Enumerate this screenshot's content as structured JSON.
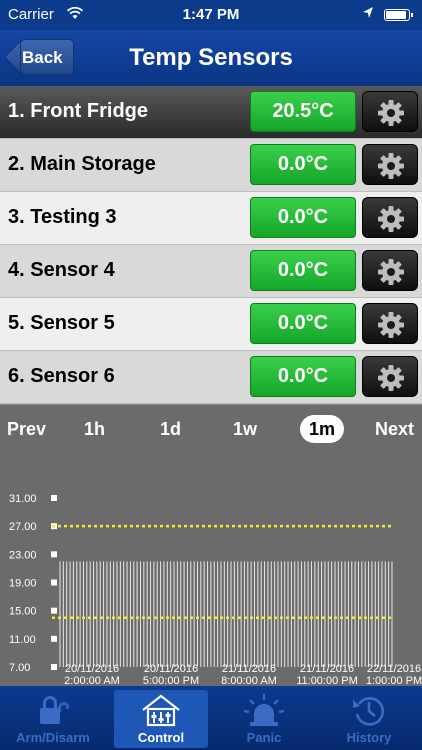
{
  "status_bar": {
    "carrier": "Carrier",
    "time": "1:47 PM"
  },
  "nav": {
    "back_label": "Back",
    "title": "Temp Sensors"
  },
  "sensors": [
    {
      "name": "1. Front Fridge",
      "temp": "20.5°C"
    },
    {
      "name": "2. Main Storage",
      "temp": "0.0°C"
    },
    {
      "name": "3. Testing 3",
      "temp": "0.0°C"
    },
    {
      "name": "4. Sensor 4",
      "temp": "0.0°C"
    },
    {
      "name": "5. Sensor 5",
      "temp": "0.0°C"
    },
    {
      "name": "6. Sensor 6",
      "temp": "0.0°C"
    }
  ],
  "chart_controls": {
    "prev": "Prev",
    "h1": "1h",
    "d1": "1d",
    "w1": "1w",
    "m1": "1m",
    "next": "Next",
    "selected": "1m"
  },
  "chart_data": {
    "type": "bar",
    "y_ticks": [
      "31.00",
      "27.00",
      "23.00",
      "19.00",
      "15.00",
      "11.00",
      "7.00"
    ],
    "ylim": [
      7.0,
      31.0
    ],
    "x_tick_labels": [
      {
        "date": "20/11/2016",
        "time": "2:00:00 AM"
      },
      {
        "date": "20/11/2016",
        "time": "5:00:00 PM"
      },
      {
        "date": "21/11/2016",
        "time": "8:00:00 AM"
      },
      {
        "date": "21/11/2016",
        "time": "11:00:00 PM"
      },
      {
        "date": "22/11/2016",
        "time": "1:00:00 PM"
      }
    ],
    "upper_threshold": 27.0,
    "lower_threshold": 14.0,
    "bar_value": 22.0,
    "bar_count": 100,
    "colors": {
      "bars": "#ffffff",
      "thresholds": "#f5ee30",
      "background": "#6b6b6b"
    }
  },
  "tabs": [
    {
      "label": "Arm/Disarm",
      "icon": "lock-icon",
      "active": false
    },
    {
      "label": "Control",
      "icon": "house-control-icon",
      "active": true
    },
    {
      "label": "Panic",
      "icon": "alarm-light-icon",
      "active": false
    },
    {
      "label": "History",
      "icon": "history-clock-icon",
      "active": false
    }
  ]
}
